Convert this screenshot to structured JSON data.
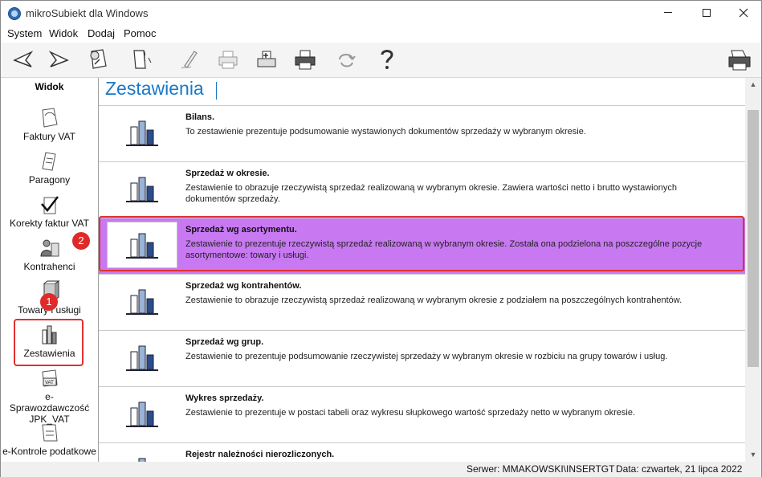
{
  "window": {
    "title": "mikroSubiekt dla Windows"
  },
  "menu": [
    "System",
    "Widok",
    "Dodaj",
    "Pomoc"
  ],
  "toolbar": {
    "icons": [
      "back-arrow-icon",
      "forward-arrow-icon",
      "settings-form-icon",
      "document-icon",
      "edit-pen-icon",
      "printer-icon",
      "fiscal-printer-icon",
      "printer-icon",
      "refresh-icon",
      "help-icon",
      "settings-printer-icon"
    ]
  },
  "sidebar": {
    "header": "Widok",
    "items": [
      {
        "label": "Faktury VAT",
        "icon": "invoice-icon"
      },
      {
        "label": "Paragony",
        "icon": "receipt-icon"
      },
      {
        "label": "Korekty faktur VAT",
        "icon": "correction-icon"
      },
      {
        "label": "Kontrahenci",
        "icon": "contractors-icon"
      },
      {
        "label": "Towary i usługi",
        "icon": "goods-icon"
      },
      {
        "label": "Zestawienia",
        "icon": "reports-icon"
      },
      {
        "label": "e-Sprawozdawczość JPK_VAT",
        "icon": "jpk-vat-icon"
      },
      {
        "label": "e-Kontrole podatkowe",
        "icon": "tax-control-icon"
      }
    ]
  },
  "main": {
    "title": "Zestawienia",
    "reports": [
      {
        "title": "Bilans.",
        "desc": "To zestawienie prezentuje podsumowanie wystawionych dokumentów sprzedaży w wybranym okresie."
      },
      {
        "title": "Sprzedaż w okresie.",
        "desc": "Zestawienie to obrazuje rzeczywistą sprzedaż realizowaną w wybranym okresie. Zawiera wartości netto i brutto wystawionych dokumentów sprzedaży."
      },
      {
        "title": "Sprzedaż wg asortymentu.",
        "desc": "Zestawienie to prezentuje rzeczywistą sprzedaż realizowaną w wybranym okresie. Została ona podzielona na poszczególne pozycje asortymentowe: towary i usługi."
      },
      {
        "title": "Sprzedaż wg kontrahentów.",
        "desc": "Zestawienie to obrazuje rzeczywistą sprzedaż realizowaną w wybranym okresie z podziałem na poszczególnych kontrahentów."
      },
      {
        "title": "Sprzedaż wg grup.",
        "desc": "Zestawienie to prezentuje podsumowanie rzeczywistej sprzedaży w wybranym okresie w rozbiciu na grupy towarów i usług."
      },
      {
        "title": "Wykres sprzedaży.",
        "desc": "Zestawienie to prezentuje w postaci tabeli oraz wykresu słupkowego wartość sprzedaży netto w wybranym okresie."
      },
      {
        "title": "Rejestr należności nierozliczonych.",
        "desc": ""
      }
    ]
  },
  "badges": {
    "one": "1",
    "two": "2"
  },
  "status": {
    "server": "Serwer: MMAKOWSKI\\INSERTGT",
    "date": "Data: czwartek, 21 lipca 2022"
  },
  "colors": {
    "title_blue": "#1a78c8",
    "active_row": "#c879f2",
    "annotation_red": "#e03030"
  }
}
